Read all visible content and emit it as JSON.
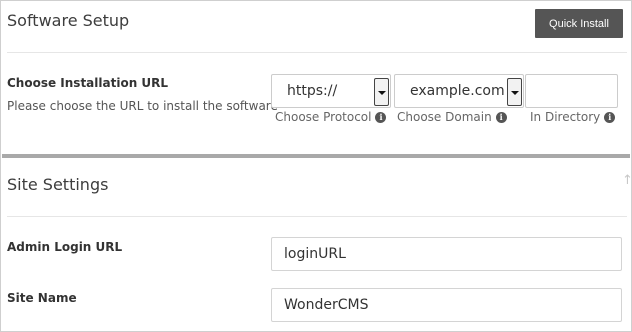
{
  "software_setup": {
    "title": "Software Setup",
    "quick_install_label": "Quick Install"
  },
  "installation_url": {
    "label": "Choose Installation URL",
    "help": "Please choose the URL to install the software",
    "protocol_value": "https://",
    "protocol_caption": "Choose Protocol",
    "domain_value": "example.com",
    "domain_caption": "Choose Domain",
    "directory_value": "",
    "directory_caption": "In Directory",
    "info_glyph": "i"
  },
  "site_settings": {
    "title": "Site Settings",
    "admin_login_label": "Admin Login URL",
    "admin_login_value": "loginURL",
    "site_name_label": "Site Name",
    "site_name_value": "WonderCMS"
  },
  "colors": {
    "button_bg": "#555555",
    "divider": "#a9a9a9"
  }
}
